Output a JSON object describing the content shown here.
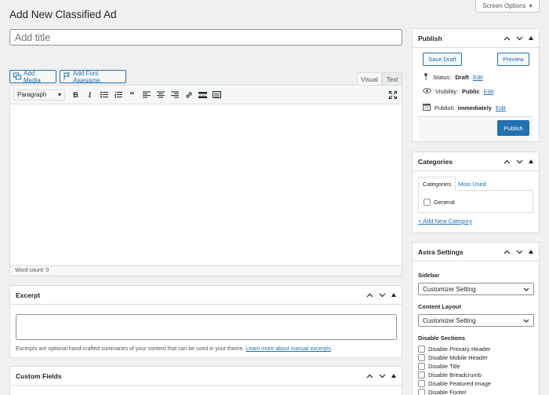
{
  "page": {
    "title": "Add New Classified Ad",
    "screen_options": "Screen Options"
  },
  "title_input": {
    "placeholder": "Add title"
  },
  "media": {
    "add_media": "Add Media",
    "add_font_awesome": "Add Font Awesome"
  },
  "editor": {
    "tabs": [
      "Visual",
      "Text"
    ],
    "format_select": "Paragraph",
    "word_count": "Word count: 0"
  },
  "excerpt": {
    "title": "Excerpt",
    "help": "Excerpts are optional hand-crafted summaries of your content that can be used in your theme.",
    "help_link": "Learn more about manual excerpts",
    "help_end": "."
  },
  "custom_fields": {
    "title": "Custom Fields"
  },
  "publish": {
    "title": "Publish",
    "save_draft": "Save Draft",
    "preview": "Preview",
    "status_label": "Status:",
    "status_value": "Draft",
    "visibility_label": "Visibility:",
    "visibility_value": "Public",
    "publish_label": "Publish",
    "publish_value": "immediately",
    "edit": "Edit",
    "publish_button": "Publish"
  },
  "categories": {
    "title": "Categories",
    "tabs": [
      "Categories",
      "Most Used"
    ],
    "items": [
      "General"
    ],
    "add_new": "+ Add New Category"
  },
  "astra": {
    "title": "Astra Settings",
    "sidebar_label": "Sidebar",
    "sidebar_value": "Customizer Setting",
    "layout_label": "Content Layout",
    "layout_value": "Customizer Setting",
    "disable_label": "Disable Sections",
    "disable_items": [
      "Disable Primary Header",
      "Disable Mobile Header",
      "Disable Title",
      "Disable Breadcrumb",
      "Disable Featured Image",
      "Disable Footer"
    ]
  },
  "colors": {
    "accent": "#2271b1",
    "background": "#f0f0f1"
  }
}
